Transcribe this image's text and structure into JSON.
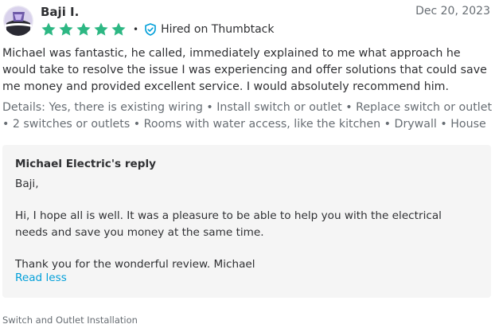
{
  "review": {
    "reviewer_name": "Baji I.",
    "date": "Dec 20, 2023",
    "rating": 5,
    "rating_max": 5,
    "star_color": "#2db783",
    "separator": "•",
    "hired_badge": {
      "icon": "shield-check-icon",
      "label": "Hired on Thumbtack",
      "color": "#009fd9"
    },
    "text": "Michael was fantastic, he called, immediately explained to me what approach he would take to resolve the issue I was experiencing and offer solutions that could save me money and provided excellent service. I would absolutely recommend him.",
    "details": "Details: Yes, there is existing wiring • Install switch or outlet • Replace switch or outlet • 2 switches or outlets • Rooms with water access, like the kitchen • Drywall • House"
  },
  "reply": {
    "title": "Michael Electric's reply",
    "greeting": "Baji,",
    "body": "Hi, I hope all is well. It was a pleasure to be able to help you with the electrical needs and save you money at the same time.",
    "closing": "Thank you for the wonderful review. Michael",
    "toggle_label": "Read less",
    "link_color": "#009fd9"
  },
  "service": {
    "label": "Switch and Outlet Installation"
  }
}
